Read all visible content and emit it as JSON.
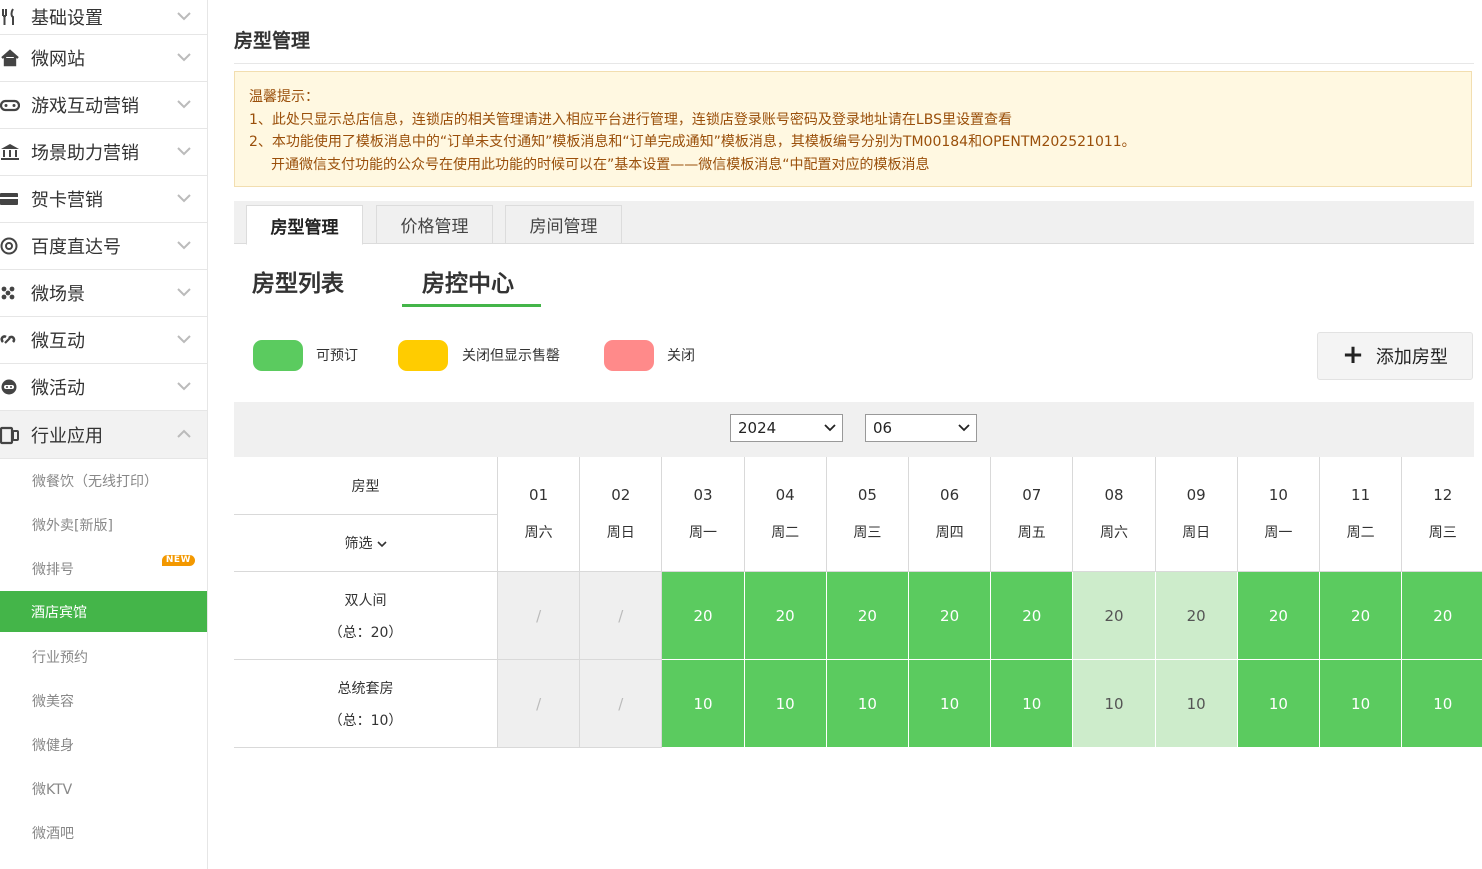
{
  "sidebar": {
    "menus": [
      {
        "label": "基础设置",
        "icon": "utensils-icon"
      },
      {
        "label": "微网站",
        "icon": "home-icon"
      },
      {
        "label": "游戏互动营销",
        "icon": "gamepad-icon"
      },
      {
        "label": "场景助力营销",
        "icon": "bank-icon"
      },
      {
        "label": "贺卡营销",
        "icon": "card-icon"
      },
      {
        "label": "百度直达号",
        "icon": "at-icon"
      },
      {
        "label": "微场景",
        "icon": "dots-icon"
      },
      {
        "label": "微互动",
        "icon": "chain-icon"
      },
      {
        "label": "微活动",
        "icon": "robot-icon"
      },
      {
        "label": "行业应用",
        "icon": "device-icon"
      }
    ],
    "sub_items": [
      {
        "label": "微餐饮（无线打印）"
      },
      {
        "label": "微外卖[新版]"
      },
      {
        "label": "微排号",
        "badge": "NEW"
      },
      {
        "label": "酒店宾馆"
      },
      {
        "label": "行业预约"
      },
      {
        "label": "微美容"
      },
      {
        "label": "微健身"
      },
      {
        "label": "微KTV"
      },
      {
        "label": "微酒吧"
      }
    ],
    "active_sub": "酒店宾馆",
    "accent_color": "#44b549"
  },
  "page": {
    "title": "房型管理"
  },
  "notice": {
    "heading": "温馨提示：",
    "line1": "1、此处只显示总店信息，连锁店的相关管理请进入相应平台进行管理，连锁店登录账号密码及登录地址请在LBS里设置查看",
    "line2": "2、本功能使用了模板消息中的“订单未支付通知”模板消息和“订单完成通知”模板消息，其模板编号分别为TM00184和OPENTM202521011。",
    "line3": "开通微信支付功能的公众号在使用此功能的时候可以在”基本设置——微信模板消息“中配置对应的模板消息"
  },
  "tabs": [
    {
      "label": "房型管理",
      "active": true
    },
    {
      "label": "价格管理",
      "active": false
    },
    {
      "label": "房间管理",
      "active": false
    }
  ],
  "subtabs": [
    {
      "label": "房型列表",
      "active": false
    },
    {
      "label": "房控中心",
      "active": true
    }
  ],
  "legend": [
    {
      "label": "可预订",
      "color": "#5bcb5f"
    },
    {
      "label": "关闭但显示售罄",
      "color": "#ffcc00"
    },
    {
      "label": "关闭",
      "color": "#ff8a8a"
    }
  ],
  "add_button": {
    "label": "添加房型"
  },
  "filters": {
    "year": "2024",
    "month": "06"
  },
  "table": {
    "header_room": "房型",
    "header_filter": "筛选",
    "days": [
      {
        "date": "01",
        "weekday": "周六"
      },
      {
        "date": "02",
        "weekday": "周日"
      },
      {
        "date": "03",
        "weekday": "周一"
      },
      {
        "date": "04",
        "weekday": "周二"
      },
      {
        "date": "05",
        "weekday": "周三"
      },
      {
        "date": "06",
        "weekday": "周四"
      },
      {
        "date": "07",
        "weekday": "周五"
      },
      {
        "date": "08",
        "weekday": "周六"
      },
      {
        "date": "09",
        "weekday": "周日"
      },
      {
        "date": "10",
        "weekday": "周一"
      },
      {
        "date": "11",
        "weekday": "周二"
      },
      {
        "date": "12",
        "weekday": "周三"
      }
    ],
    "rows": [
      {
        "name": "双人间",
        "total": "（总：20）",
        "cells": [
          {
            "value": "/",
            "state": "na"
          },
          {
            "value": "/",
            "state": "na"
          },
          {
            "value": "20",
            "state": "open"
          },
          {
            "value": "20",
            "state": "open"
          },
          {
            "value": "20",
            "state": "open"
          },
          {
            "value": "20",
            "state": "open"
          },
          {
            "value": "20",
            "state": "open"
          },
          {
            "value": "20",
            "state": "weekend"
          },
          {
            "value": "20",
            "state": "weekend"
          },
          {
            "value": "20",
            "state": "open"
          },
          {
            "value": "20",
            "state": "open"
          },
          {
            "value": "20",
            "state": "open"
          }
        ]
      },
      {
        "name": "总统套房",
        "total": "（总：10）",
        "cells": [
          {
            "value": "/",
            "state": "na"
          },
          {
            "value": "/",
            "state": "na"
          },
          {
            "value": "10",
            "state": "open"
          },
          {
            "value": "10",
            "state": "open"
          },
          {
            "value": "10",
            "state": "open"
          },
          {
            "value": "10",
            "state": "open"
          },
          {
            "value": "10",
            "state": "open"
          },
          {
            "value": "10",
            "state": "weekend"
          },
          {
            "value": "10",
            "state": "weekend"
          },
          {
            "value": "10",
            "state": "open"
          },
          {
            "value": "10",
            "state": "open"
          },
          {
            "value": "10",
            "state": "open"
          }
        ]
      }
    ]
  }
}
